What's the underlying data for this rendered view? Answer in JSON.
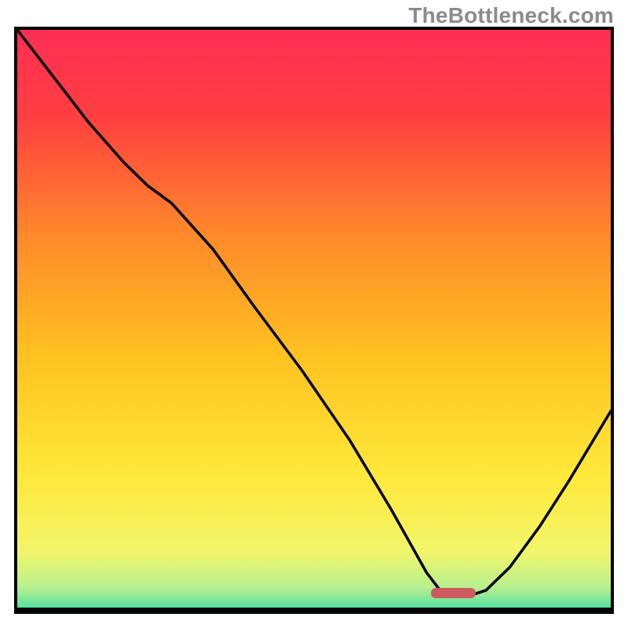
{
  "watermark": "TheBottleneck.com",
  "gradient": {
    "stops": [
      {
        "offset": 0.0,
        "color": "#ff2d55"
      },
      {
        "offset": 0.15,
        "color": "#ff4040"
      },
      {
        "offset": 0.35,
        "color": "#ff8a2a"
      },
      {
        "offset": 0.55,
        "color": "#ffc220"
      },
      {
        "offset": 0.75,
        "color": "#ffe83a"
      },
      {
        "offset": 0.88,
        "color": "#f2f56a"
      },
      {
        "offset": 0.94,
        "color": "#b7f090"
      },
      {
        "offset": 0.975,
        "color": "#52e0a0"
      },
      {
        "offset": 1.0,
        "color": "#1fd592"
      }
    ]
  },
  "marker": {
    "x_frac": 0.735,
    "y_frac": 0.975,
    "width_frac": 0.075,
    "height_frac": 0.018
  },
  "chart_data": {
    "type": "line",
    "title": "",
    "xlabel": "",
    "ylabel": "",
    "xlim": [
      0,
      1
    ],
    "ylim": [
      0,
      1
    ],
    "note": "Bottleneck-style curve. Axes are normalized (no tick labels shown). y=0 is optimal (green band at bottom), y=1 is worst (red at top). Curve descends steeply from upper-left, reaches a flat minimum near x≈0.71–0.79, then rises toward the right edge. A short red marker bar sits on the x-axis under the minimum.",
    "series": [
      {
        "name": "bottleneck-curve",
        "x": [
          0.0,
          0.06,
          0.12,
          0.18,
          0.22,
          0.26,
          0.33,
          0.4,
          0.48,
          0.56,
          0.63,
          0.69,
          0.72,
          0.76,
          0.79,
          0.83,
          0.88,
          0.93,
          1.0
        ],
        "y": [
          1.0,
          0.92,
          0.84,
          0.77,
          0.73,
          0.7,
          0.62,
          0.52,
          0.41,
          0.29,
          0.17,
          0.06,
          0.02,
          0.02,
          0.03,
          0.07,
          0.14,
          0.22,
          0.34
        ]
      }
    ],
    "optimal_range_x": [
      0.71,
      0.79
    ]
  }
}
